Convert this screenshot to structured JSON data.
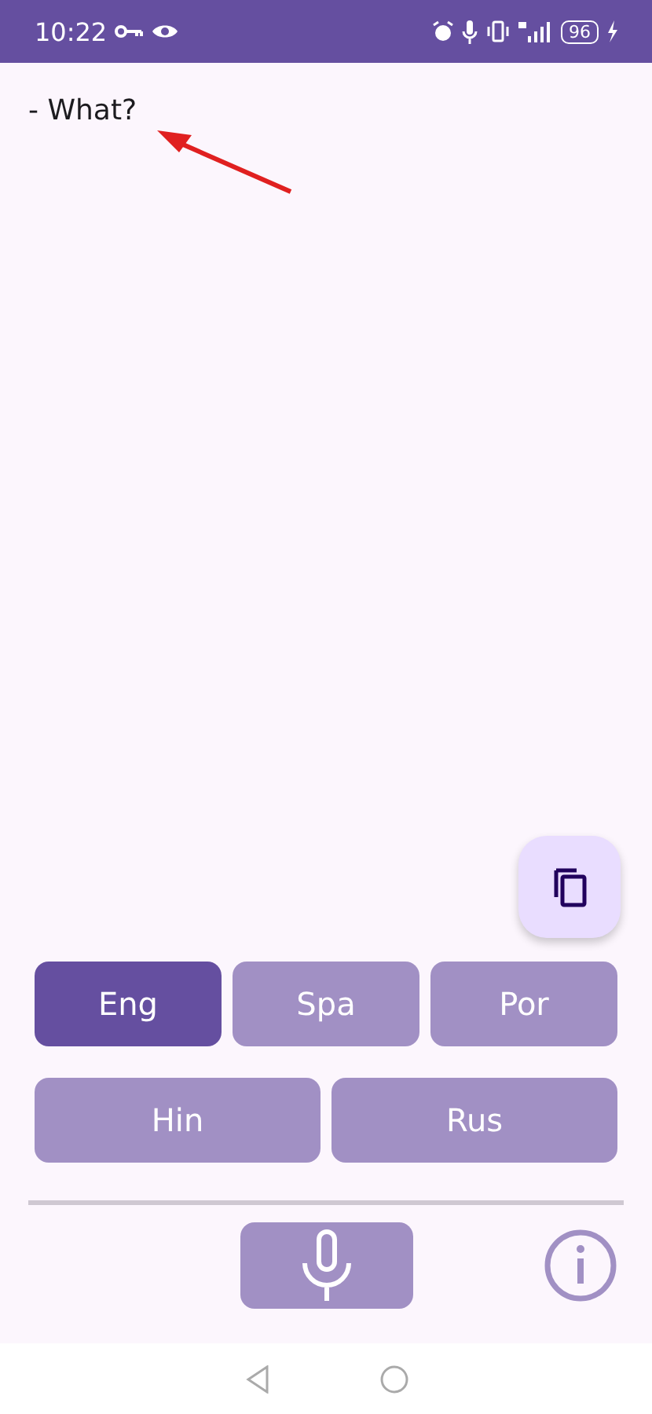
{
  "status_bar": {
    "time": "10:22",
    "battery": "96"
  },
  "transcript": {
    "text": "- What?"
  },
  "languages": [
    {
      "label": "Eng",
      "selected": true
    },
    {
      "label": "Spa",
      "selected": false
    },
    {
      "label": "Por",
      "selected": false
    },
    {
      "label": "Hin",
      "selected": false
    },
    {
      "label": "Rus",
      "selected": false
    }
  ]
}
